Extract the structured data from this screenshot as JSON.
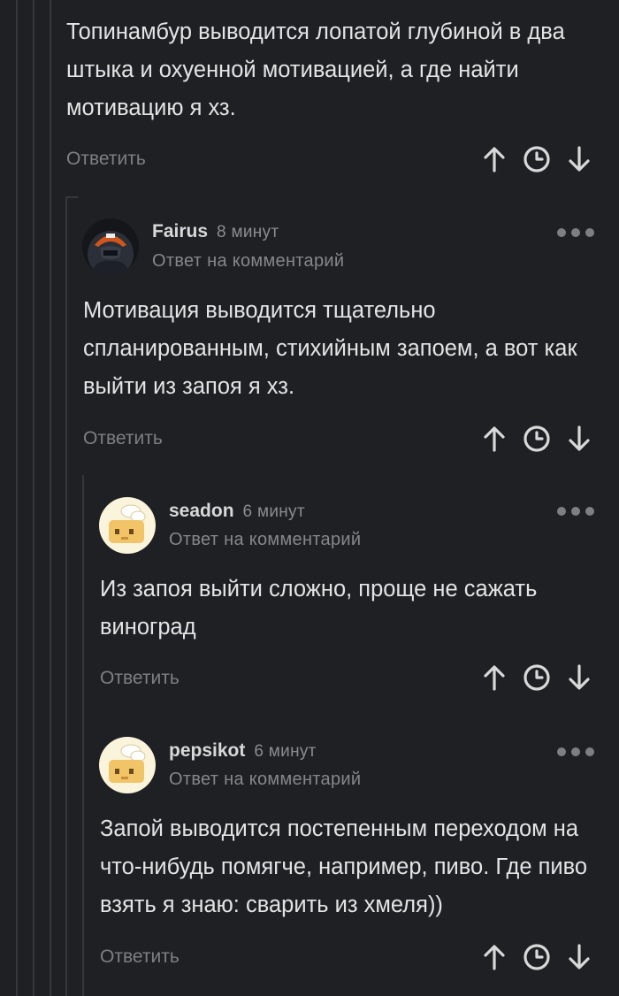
{
  "top_comment": {
    "text": "Топинамбур выводится лопатой глубиной в два штыка и охуенной мотивацией, а где найти мотивацию я хз.",
    "reply_label": "Ответить"
  },
  "comments": [
    {
      "author": "Fairus",
      "time": "8 минут",
      "subtitle": "Ответ на комментарий",
      "text": "Мотивация выводится тщательно спланированным, стихийным запоем, а вот как выйти из запоя я хз.",
      "reply_label": "Ответить",
      "avatar": "user-photo-avatar"
    },
    {
      "author": "seadon",
      "time": "6 минут",
      "subtitle": "Ответ на комментарий",
      "text": "Из запоя выйти сложно, проще не сажать виноград",
      "reply_label": "Ответить",
      "avatar": "default-chef-avatar"
    },
    {
      "author": "pepsikot",
      "time": "6 минут",
      "subtitle": "Ответ на комментарий",
      "text": "Запой выводится постепенным переходом на что-нибудь помягче, например, пиво. Где пиво взять я знаю: сварить из хмеля))",
      "reply_label": "Ответить",
      "avatar": "default-chef-avatar"
    }
  ],
  "icons": {
    "upvote": "arrow-up-icon",
    "history": "clock-icon",
    "downvote": "arrow-down-icon",
    "more": "more-dots-icon"
  },
  "colors": {
    "background": "#1f2023",
    "text": "#e4e4e4",
    "muted": "#7d7f83",
    "thread_line": "#35373b"
  }
}
